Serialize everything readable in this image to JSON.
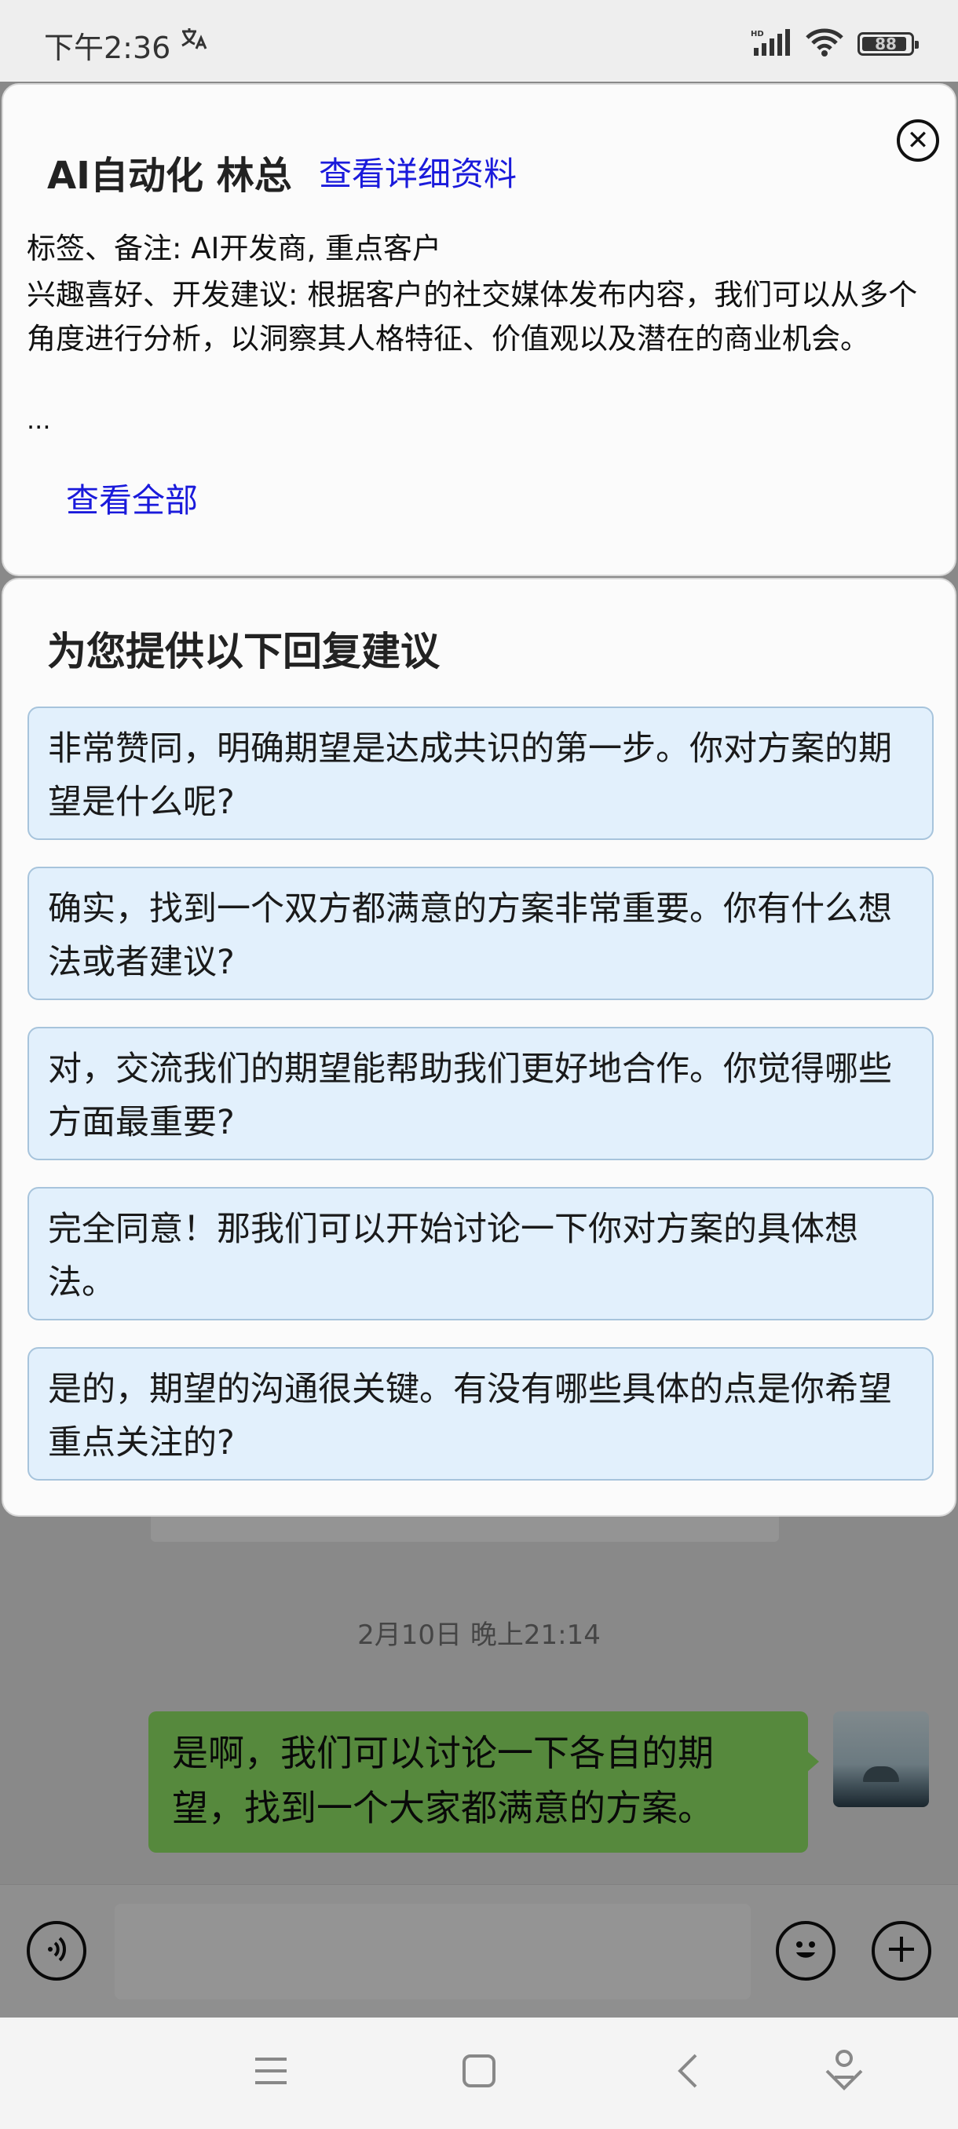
{
  "status_bar": {
    "time": "下午2:36",
    "battery": "88"
  },
  "profile": {
    "name": "AI自动化 林总",
    "details_link": "查看详细资料",
    "tags": "标签、备注: AI开发商, 重点客户",
    "interests": "兴趣喜好、开发建议: 根据客户的社交媒体发布内容，我们可以从多个角度进行分析，以洞察其人格特征、价值观以及潜在的商业机会。",
    "ellipsis": "...",
    "view_all": "查看全部"
  },
  "suggestions": {
    "title": "为您提供以下回复建议",
    "items": [
      "非常赞同，明确期望是达成共识的第一步。你对方案的期望是什么呢?",
      "确实，找到一个双方都满意的方案非常重要。你有什么想法或者建议?",
      "对，交流我们的期望能帮助我们更好地合作。你觉得哪些方面最重要?",
      "完全同意！那我们可以开始讨论一下你对方案的具体想法。",
      "是的，期望的沟通很关键。有没有哪些具体的点是你希望重点关注的?"
    ]
  },
  "chat": {
    "timestamp": "2月10日 晚上21:14",
    "my_message": "是啊，我们可以讨论一下各自的期望，找到一个大家都满意的方案。"
  },
  "icons": {
    "close": "close-icon",
    "voice": "voice-icon",
    "emoji": "emoji-icon",
    "add": "add-icon",
    "menu": "menu-icon",
    "home": "home-icon",
    "back": "back-icon",
    "assistant": "assistant-icon"
  },
  "colors": {
    "link": "#1a1adb",
    "suggestion_bg": "#e2f0fc",
    "suggestion_border": "#a7c4dc",
    "my_bubble": "#95ec69"
  }
}
